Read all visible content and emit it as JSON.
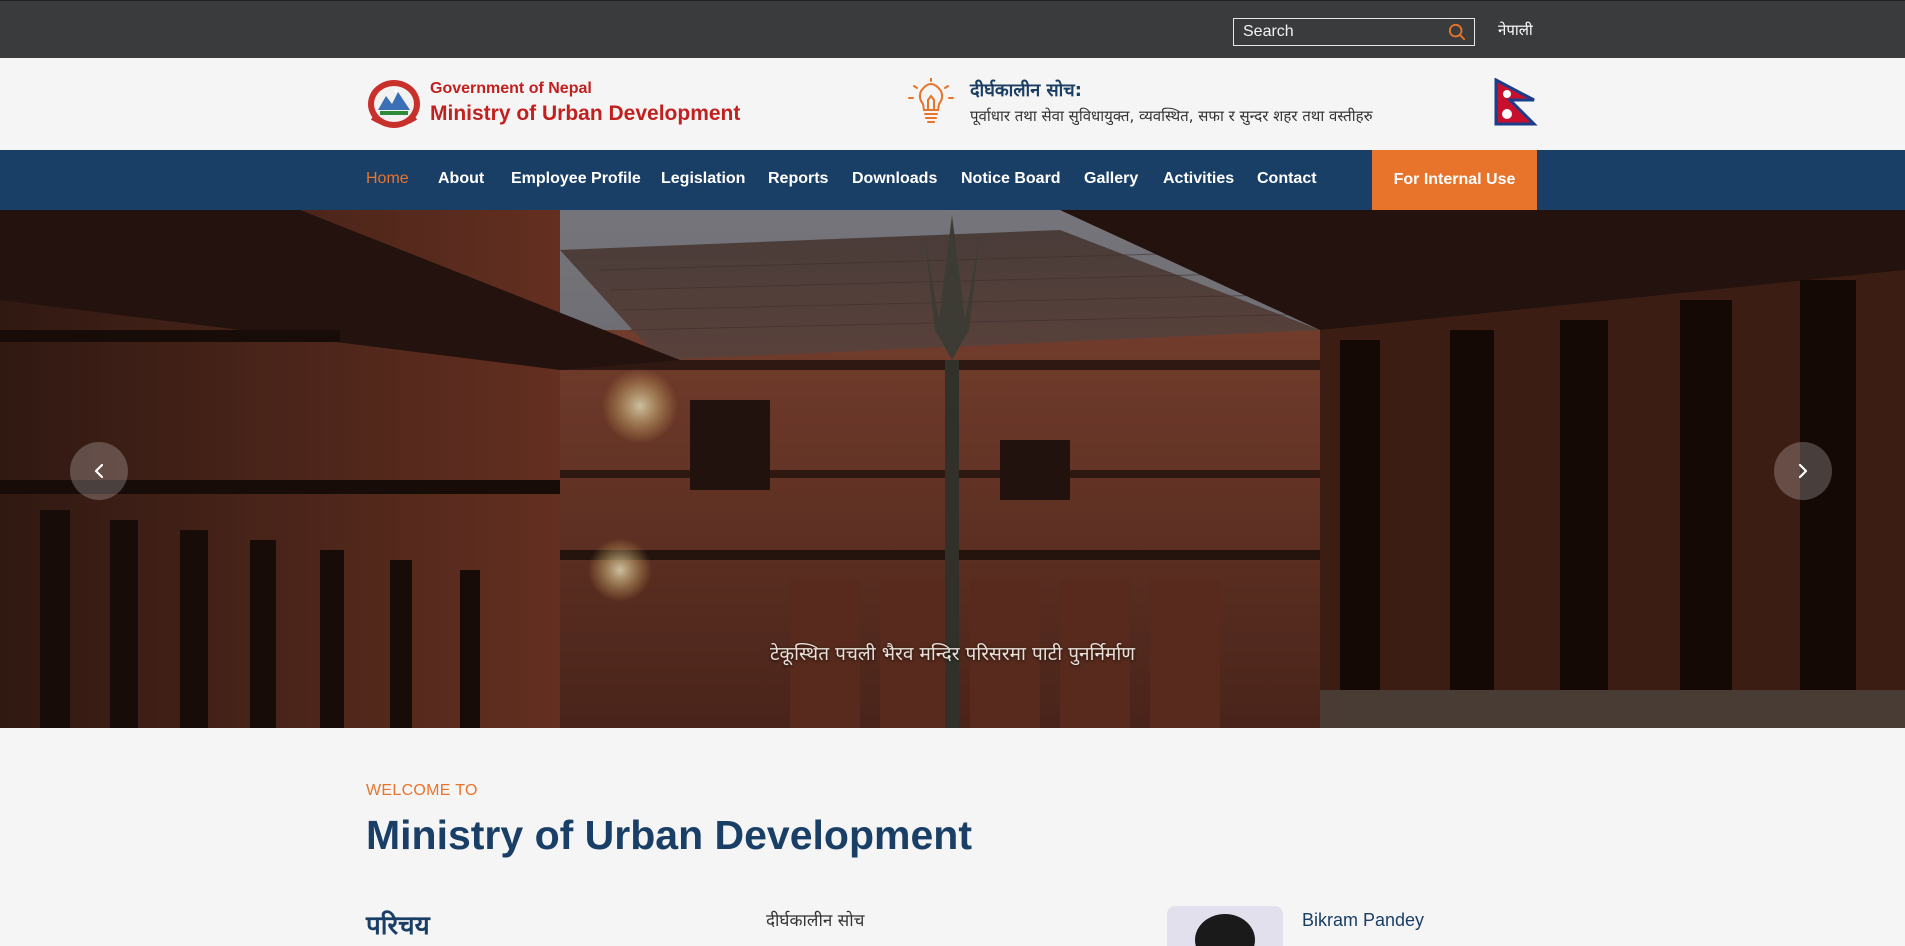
{
  "topbar": {
    "search_placeholder": "Search",
    "language_link": "नेपाली"
  },
  "header": {
    "gov_name": "Government of Nepal",
    "ministry_name": "Ministry of Urban Development",
    "vision_title": "दीर्घकालीन सोच:",
    "vision_text": "पूर्वाधार तथा सेवा सुविधायुक्त, व्यवस्थित, सफा र सुन्दर शहर तथा वस्तीहरु"
  },
  "nav": {
    "items": [
      {
        "label": "Home"
      },
      {
        "label": "About"
      },
      {
        "label": "Employee Profile"
      },
      {
        "label": "Legislation"
      },
      {
        "label": "Reports"
      },
      {
        "label": "Downloads"
      },
      {
        "label": "Notice Board"
      },
      {
        "label": "Gallery"
      },
      {
        "label": "Activities"
      },
      {
        "label": "Contact"
      }
    ],
    "active_item": "Home",
    "internal_button": "For Internal Use"
  },
  "hero": {
    "caption": "टेकूस्थित पचली भैरव मन्दिर परिसरमा पाटी पुनर्निर्माण"
  },
  "welcome": {
    "kicker": "WELCOME TO",
    "title": "Ministry of Urban Development"
  },
  "sections": {
    "intro_heading": "परिचय",
    "vision_heading": "दीर्घकालीन सोच",
    "person_name": "Bikram Pandey"
  },
  "colors": {
    "topbar_bg": "#3a3b3d",
    "nav_bg": "#1a3f66",
    "accent_orange": "#e8742c",
    "brand_red": "#c21f1f"
  },
  "icons": [
    "search-icon",
    "lightbulb-icon",
    "nepal-emblem-icon",
    "nepal-flag-icon",
    "chevron-left-icon",
    "chevron-right-icon"
  ]
}
